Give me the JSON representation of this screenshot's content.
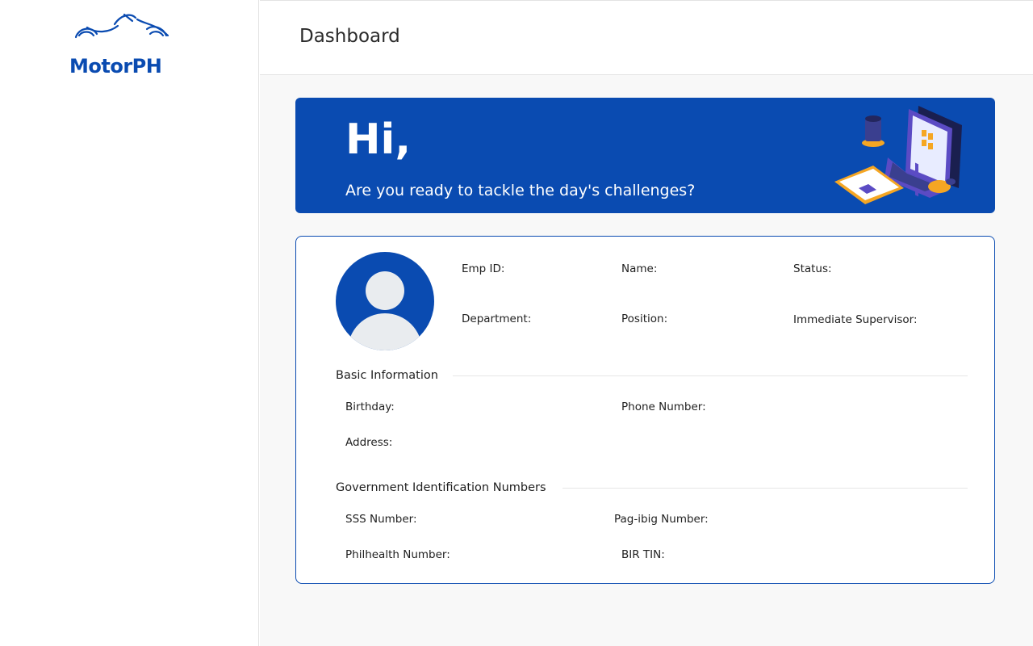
{
  "brand": {
    "name": "MotorPH",
    "color": "#0a4bb1",
    "logo_icon": "motorcycle-icon"
  },
  "header": {
    "title": "Dashboard"
  },
  "banner": {
    "greeting": "Hi,",
    "message": "Are you ready to tackle the day's challenges?",
    "illustration": "laptop-workspace-illustration",
    "background": "#0a4bb1"
  },
  "profile": {
    "avatar_icon": "user-avatar-icon",
    "fields": {
      "emp_id": "Emp ID:",
      "name": "Name:",
      "status": "Status:",
      "department": "Department:",
      "position": "Position:",
      "supervisor": "Immediate Supervisor:"
    }
  },
  "basic_info": {
    "title": "Basic Information",
    "birthday": "Birthday:",
    "phone": "Phone Number:",
    "address": "Address:"
  },
  "government_ids": {
    "title": "Government Identification Numbers",
    "sss": "SSS Number:",
    "pagibig": "Pag-ibig Number:",
    "philhealth": "Philhealth Number:",
    "tin": "BIR TIN:"
  }
}
